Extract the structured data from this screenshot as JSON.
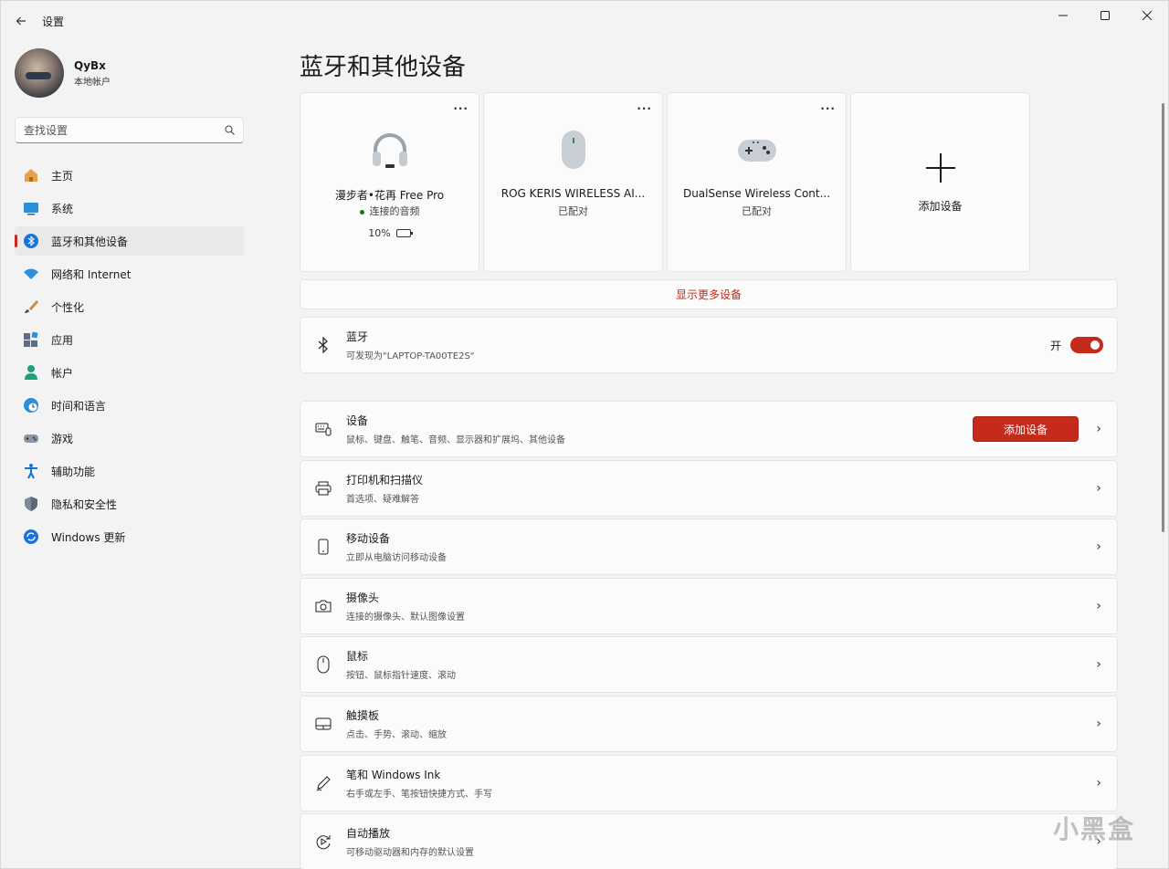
{
  "app": {
    "title": "设置",
    "back_icon": "arrow-left-icon"
  },
  "window_controls": [
    "minimize-icon",
    "maximize-icon",
    "close-icon"
  ],
  "profile": {
    "name": "QyBx",
    "account_type": "本地帐户"
  },
  "search": {
    "placeholder": "查找设置"
  },
  "nav": {
    "items": [
      {
        "label": "主页",
        "icon": "home-icon"
      },
      {
        "label": "系统",
        "icon": "system-icon"
      },
      {
        "label": "蓝牙和其他设备",
        "icon": "bluetooth-icon",
        "active": true
      },
      {
        "label": "网络和 Internet",
        "icon": "wifi-icon"
      },
      {
        "label": "个性化",
        "icon": "brush-icon"
      },
      {
        "label": "应用",
        "icon": "apps-icon"
      },
      {
        "label": "帐户",
        "icon": "account-icon"
      },
      {
        "label": "时间和语言",
        "icon": "globe-clock-icon"
      },
      {
        "label": "游戏",
        "icon": "gamepad-icon"
      },
      {
        "label": "辅助功能",
        "icon": "accessibility-icon"
      },
      {
        "label": "隐私和安全性",
        "icon": "shield-icon"
      },
      {
        "label": "Windows 更新",
        "icon": "update-icon"
      }
    ]
  },
  "main": {
    "title": "蓝牙和其他设备",
    "devices": [
      {
        "name": "漫步者•花再 Free Pro",
        "status": "连接的音频",
        "battery": "10%",
        "icon": "headphones-icon",
        "connected": true
      },
      {
        "name": "ROG KERIS WIRELESS AI...",
        "status": "已配对",
        "icon": "mouse-icon"
      },
      {
        "name": "DualSense Wireless Cont...",
        "status": "已配对",
        "icon": "gamepad-icon"
      }
    ],
    "add_device_card": {
      "label": "添加设备",
      "icon": "plus-icon"
    },
    "more_button": "显示更多设备",
    "bluetooth": {
      "title": "蓝牙",
      "subtitle": "可发现为\"LAPTOP-TA00TE2S\"",
      "state_label": "开",
      "enabled": true
    },
    "settings_rows": [
      {
        "title": "设备",
        "subtitle": "鼠标、键盘、触笔、音频、显示器和扩展坞、其他设备",
        "icon": "devices-icon",
        "button": "添加设备"
      },
      {
        "title": "打印机和扫描仪",
        "subtitle": "首选项、疑难解答",
        "icon": "printer-icon"
      },
      {
        "title": "移动设备",
        "subtitle": "立即从电脑访问移动设备",
        "icon": "phone-icon"
      },
      {
        "title": "摄像头",
        "subtitle": "连接的摄像头、默认图像设置",
        "icon": "camera-icon"
      },
      {
        "title": "鼠标",
        "subtitle": "按钮、鼠标指针速度、滚动",
        "icon": "mouse-icon"
      },
      {
        "title": "触摸板",
        "subtitle": "点击、手势、滚动、缩放",
        "icon": "touchpad-icon"
      },
      {
        "title": "笔和 Windows Ink",
        "subtitle": "右手或左手、笔按钮快捷方式、手写",
        "icon": "pen-icon"
      },
      {
        "title": "自动播放",
        "subtitle": "可移动驱动器和内存的默认设置",
        "icon": "autoplay-icon"
      }
    ]
  },
  "colors": {
    "accent": "#c42b1c",
    "background": "#f3f3f3",
    "card": "#fbfbfb"
  },
  "watermark": "小黑盒"
}
